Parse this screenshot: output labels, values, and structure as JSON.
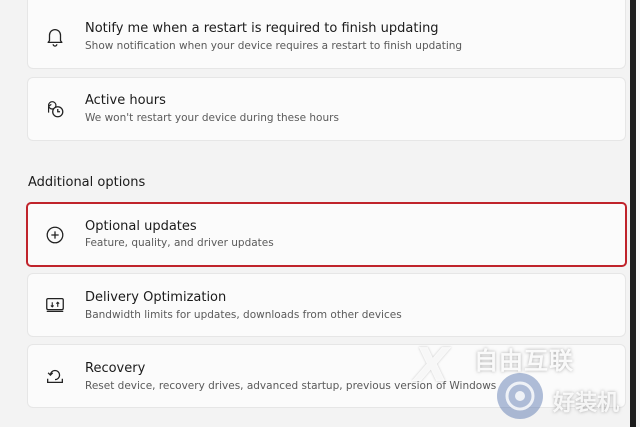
{
  "notify": {
    "title": "Notify me when a restart is required to finish updating",
    "subtitle": "Show notification when your device requires a restart to finish updating",
    "icon": "bell-icon"
  },
  "active_hours": {
    "title": "Active hours",
    "subtitle": "We won't restart your device during these hours",
    "icon": "clock-icon"
  },
  "additional_options": {
    "heading": "Additional options"
  },
  "optional_updates": {
    "title": "Optional updates",
    "subtitle": "Feature, quality, and driver updates",
    "icon": "plus-circle-icon",
    "highlight_color": "#c0232b"
  },
  "delivery_optimization": {
    "title": "Delivery Optimization",
    "subtitle": "Bandwidth limits for updates, downloads from other devices",
    "icon": "delivery-optimization-icon"
  },
  "recovery": {
    "title": "Recovery",
    "subtitle": "Reset device, recovery drives, advanced startup, previous version of Windows",
    "icon": "recovery-icon"
  },
  "watermark": {
    "brand": "自由互联",
    "brand2": "好装机"
  }
}
